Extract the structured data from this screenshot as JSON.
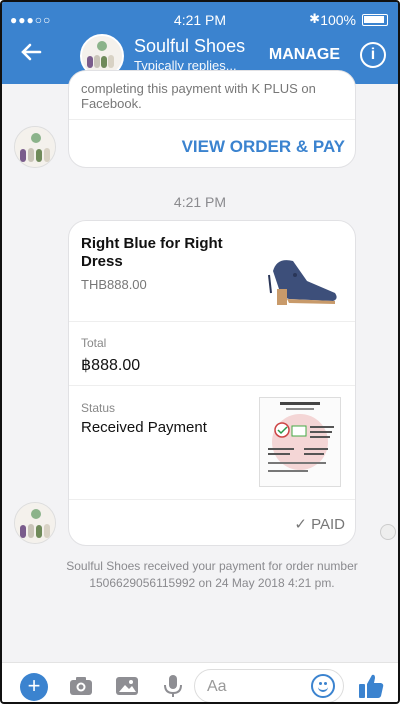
{
  "status_bar": {
    "signal": "●●●○○",
    "time": "4:21 PM",
    "bluetooth": "✱",
    "battery": "100%"
  },
  "header": {
    "back_icon": "back-arrow-icon",
    "page_name": "Soulful Shoes",
    "subtitle": "Typically replies...",
    "manage_label": "MANAGE",
    "info_icon": "info-icon"
  },
  "chat": {
    "prev_card": {
      "truncated_text": "completing this payment with K PLUS on Facebook.",
      "button_label": "VIEW ORDER & PAY"
    },
    "timestamp": "4:21 PM",
    "order_card": {
      "product_name": "Right Blue for Right Dress",
      "product_price": "THB888.00",
      "total_label": "Total",
      "total_value": "฿888.00",
      "status_label": "Status",
      "status_value": "Received Payment",
      "paid_label": "✓ PAID"
    },
    "system_message": "Soulful Shoes received your payment for order number 1506629056115992 on 24 May 2018 4:21 pm."
  },
  "composer": {
    "placeholder": "Aa",
    "icons": [
      "plus-icon",
      "camera-icon",
      "gallery-icon",
      "microphone-icon",
      "emoji-icon",
      "thumbs-up-icon"
    ]
  },
  "colors": {
    "brand": "#3b83cf",
    "bubble_bg": "#ffffff",
    "chat_bg": "#f3f3f5"
  }
}
